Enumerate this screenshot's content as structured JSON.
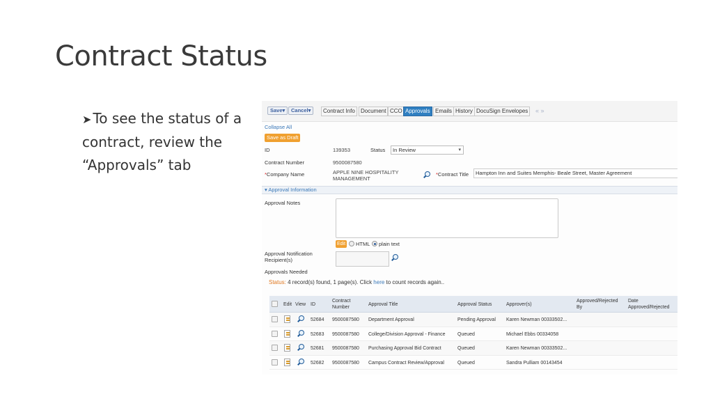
{
  "slide": {
    "title": "Contract Status",
    "bullet_line1": "To see the status of a",
    "bullet_line2": "contract, review the",
    "bullet_line3": "“Approvals” tab"
  },
  "toolbar": {
    "save": "Save▾",
    "cancel": "Cancel▾",
    "nav": "« »"
  },
  "tabs": [
    {
      "label": "Contract Info"
    },
    {
      "label": "Document"
    },
    {
      "label": "CCO"
    },
    {
      "label": "Approvals",
      "active": true
    },
    {
      "label": "Emails"
    },
    {
      "label": "History"
    },
    {
      "label": "DocuSign Envelopes"
    }
  ],
  "form": {
    "collapse_all": "Collapse All",
    "save_as_draft": "Save as Draft",
    "id_label": "ID",
    "id_value": "139353",
    "status_label": "Status",
    "status_value": "In Review",
    "contract_number_label": "Contract Number",
    "contract_number_value": "9500087580",
    "company_name_label": "Company Name",
    "company_name_value_1": "APPLE NINE HOSPITALITY",
    "company_name_value_2": "MANAGEMENT",
    "contract_title_label": "Contract Title",
    "contract_title_value": "Hampton Inn and Suites Memphis- Beale Street, Master Agreement",
    "required_mark": "*"
  },
  "approval_section": {
    "header": "▾ Approval Information",
    "notes_label": "Approval Notes",
    "edit_label": "Edit",
    "html_label": "HTML",
    "plain_text_label": "plain text",
    "recipients_label_1": "Approval Notification",
    "recipients_label_2": "Recipient(s)",
    "approvals_needed_label": "Approvals Needed"
  },
  "status_line": {
    "prefix": "Status:",
    "text_before": " 4 record(s) found, 1 page(s). Click ",
    "link": "here",
    "text_after": " to count records again.."
  },
  "grid": {
    "headers": {
      "edit": "Edit",
      "view": "View",
      "id": "ID",
      "contract_number_1": "Contract",
      "contract_number_2": "Number",
      "approval_title": "Approval Title",
      "approval_status": "Approval Status",
      "approvers": "Approver(s)",
      "approved_by_1": "Approved/Rejected",
      "approved_by_2": "By",
      "date_1": "Date",
      "date_2": "Approved/Rejected"
    },
    "rows": [
      {
        "id": "52684",
        "contract_number": "9500087580",
        "approval_title": "Department Approval",
        "approval_status": "Pending Approval",
        "approvers": "Karen Newman 00333502..."
      },
      {
        "id": "52683",
        "contract_number": "9500087580",
        "approval_title": "College/Division Approval - Finance",
        "approval_status": "Queued",
        "approvers": "Michael Ebbs 00334058"
      },
      {
        "id": "52681",
        "contract_number": "9500087580",
        "approval_title": "Purchasing Approval Bid Contract",
        "approval_status": "Queued",
        "approvers": "Karen Newman 00333502..."
      },
      {
        "id": "52682",
        "contract_number": "9500087580",
        "approval_title": "Campus Contract Review/Approval",
        "approval_status": "Queued",
        "approvers": "Sandra Pulliam 00143454"
      }
    ]
  },
  "colors": {
    "accent": "#2f7fc1",
    "orange": "#f0a030",
    "link": "#3a78b8"
  },
  "icons": [
    "search-icon",
    "edit-icon",
    "view-icon",
    "checkbox-icon",
    "dropdown-caret-icon"
  ]
}
